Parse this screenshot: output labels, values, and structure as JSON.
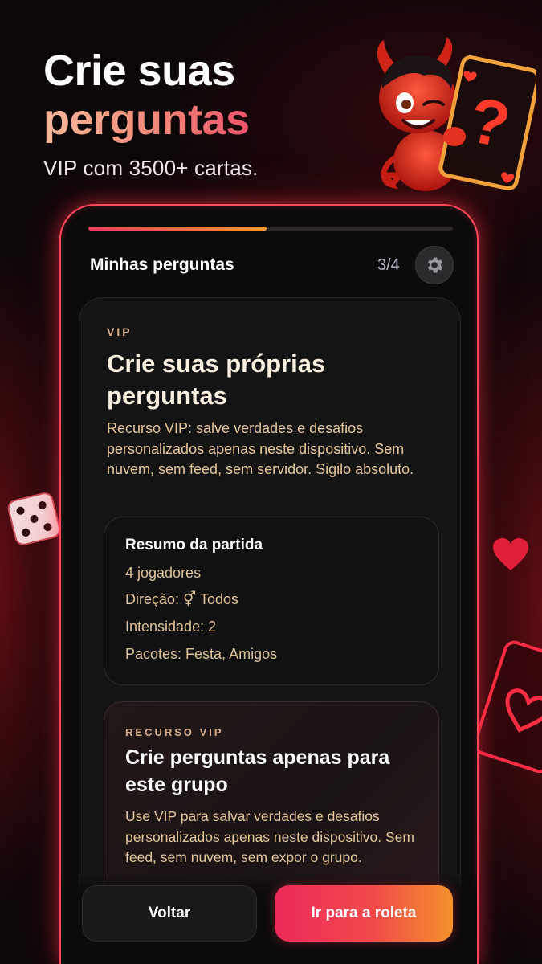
{
  "header": {
    "line1": "Crie suas",
    "line2": "perguntas",
    "subtitle": "VIP com 3500+ cartas."
  },
  "screen": {
    "title": "Minhas perguntas",
    "step": "3/4",
    "progress": 0.49,
    "settings_icon": "gear-icon"
  },
  "card": {
    "tag": "VIP",
    "title": "Crie suas próprias perguntas",
    "description": "Recurso VIP: salve verdades e desafios personalizados apenas neste dispositivo. Sem nuvem, sem feed, sem servidor. Sigilo absoluto."
  },
  "summary": {
    "title": "Resumo da partida",
    "players": "4 jogadores",
    "direction": "Direção: ⚥ Todos",
    "intensity": "Intensidade: 2",
    "packs": "Pacotes: Festa, Amigos"
  },
  "vip_feature": {
    "tag": "RECURSO VIP",
    "title": "Crie perguntas apenas para este grupo",
    "description": "Use VIP para salvar verdades e desafios personalizados apenas neste dispositivo. Sem feed, sem nuvem, sem expor o grupo."
  },
  "buttons": {
    "back": "Voltar",
    "go": "Ir para a roleta"
  },
  "colors": {
    "accent": "#ff4a5c",
    "gold_text": "#e3c79b",
    "gradient_start": "#ec2a5a",
    "gradient_end": "#f5912c"
  }
}
